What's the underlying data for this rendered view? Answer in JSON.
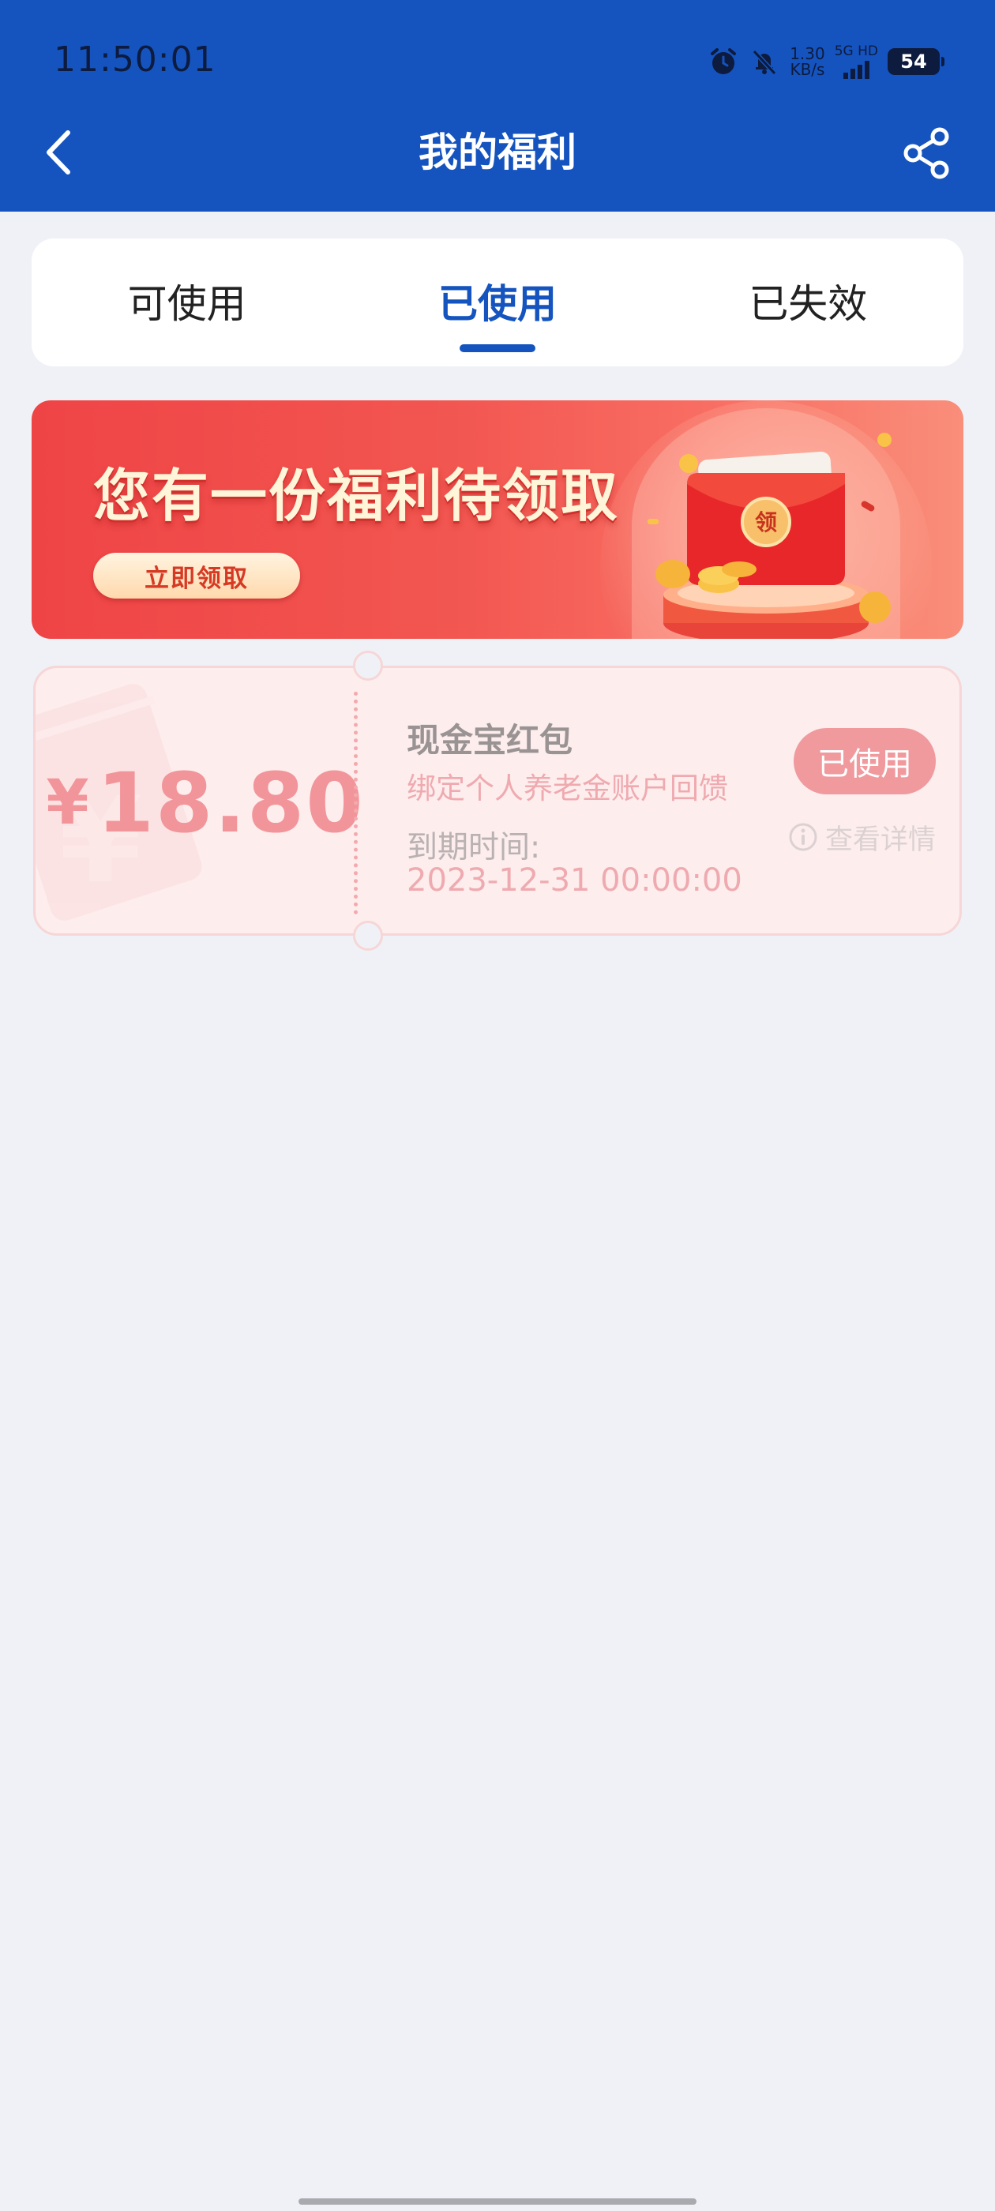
{
  "status_bar": {
    "time": "11:50:01",
    "net_speed_value": "1.30",
    "net_speed_unit": "KB/s",
    "network": "5G HD",
    "battery": "54"
  },
  "header": {
    "title": "我的福利",
    "back_icon": "chevron-left-icon",
    "share_icon": "share-icon",
    "bg_color": "#1554bf"
  },
  "tabs": [
    {
      "label": "可使用",
      "active": false
    },
    {
      "label": "已使用",
      "active": true
    },
    {
      "label": "已失效",
      "active": false
    }
  ],
  "banner": {
    "title": "您有一份福利待领取",
    "button_label": "立即领取",
    "envelope_char": "领"
  },
  "coupon": {
    "currency": "¥",
    "amount": "18.80",
    "name": "现金宝红包",
    "description": "绑定个人养老金账户回馈",
    "expire_label": "到期时间:",
    "expire_date": "2023-12-31 00:00:00",
    "status_label": "已使用",
    "detail_label": "查看详情"
  }
}
